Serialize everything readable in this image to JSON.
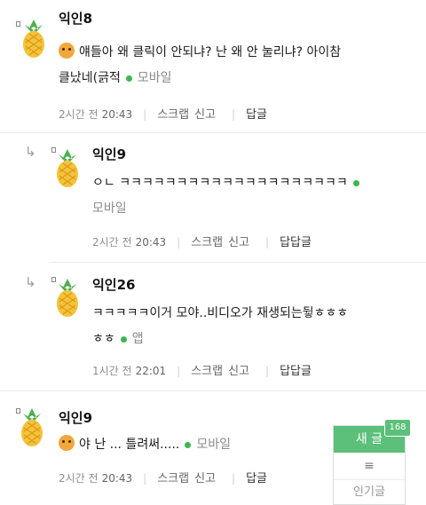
{
  "comments": [
    {
      "nickname": "익인8",
      "text_line1": "얘들아 왜 클릭이 안되냐? 난 왜 안 눌리냐? 아이참",
      "text_line2": "클났네(긁적",
      "device": "모바일",
      "time_ago": "2시간 전",
      "time": "20:43",
      "scrap": "스크랩",
      "report": "신고",
      "reply": "답글",
      "has_emoji": true
    },
    {
      "nickname": "익인9",
      "text_line1": "ㅇㄴ ㅋㅋㅋㅋㅋㅋㅋㅋㅋㅋㅋㅋㅋㅋㅋㅋㅋㅋㅋㅋ",
      "device": "모바일",
      "time_ago": "2시간 전",
      "time": "20:43",
      "scrap": "스크랩",
      "report": "신고",
      "reply": "답답글"
    },
    {
      "nickname": "익인26",
      "text_line1": "ㅋㅋㅋㅋㅋ이거 모야..비디오가 재생되는뒿ㅎㅎㅎ",
      "text_line2": "ㅎㅎ",
      "device": "앱",
      "time_ago": "1시간 전",
      "time": "22:01",
      "scrap": "스크랩",
      "report": "신고",
      "reply": "답답글"
    },
    {
      "nickname": "익인9",
      "text_line1": "야 난 ... 틀려써.....",
      "device": "모바일",
      "time_ago": "2시간 전",
      "time": "20:43",
      "scrap": "스크랩",
      "report": "신고",
      "reply": "답글",
      "has_emoji": true
    }
  ],
  "floating_menu": {
    "new_post": "새 글",
    "count": "168",
    "menu": "≡",
    "popular": "인기글"
  },
  "colors": {
    "accent_green": "#5cbf7a",
    "device_dot": "#3cb650"
  }
}
